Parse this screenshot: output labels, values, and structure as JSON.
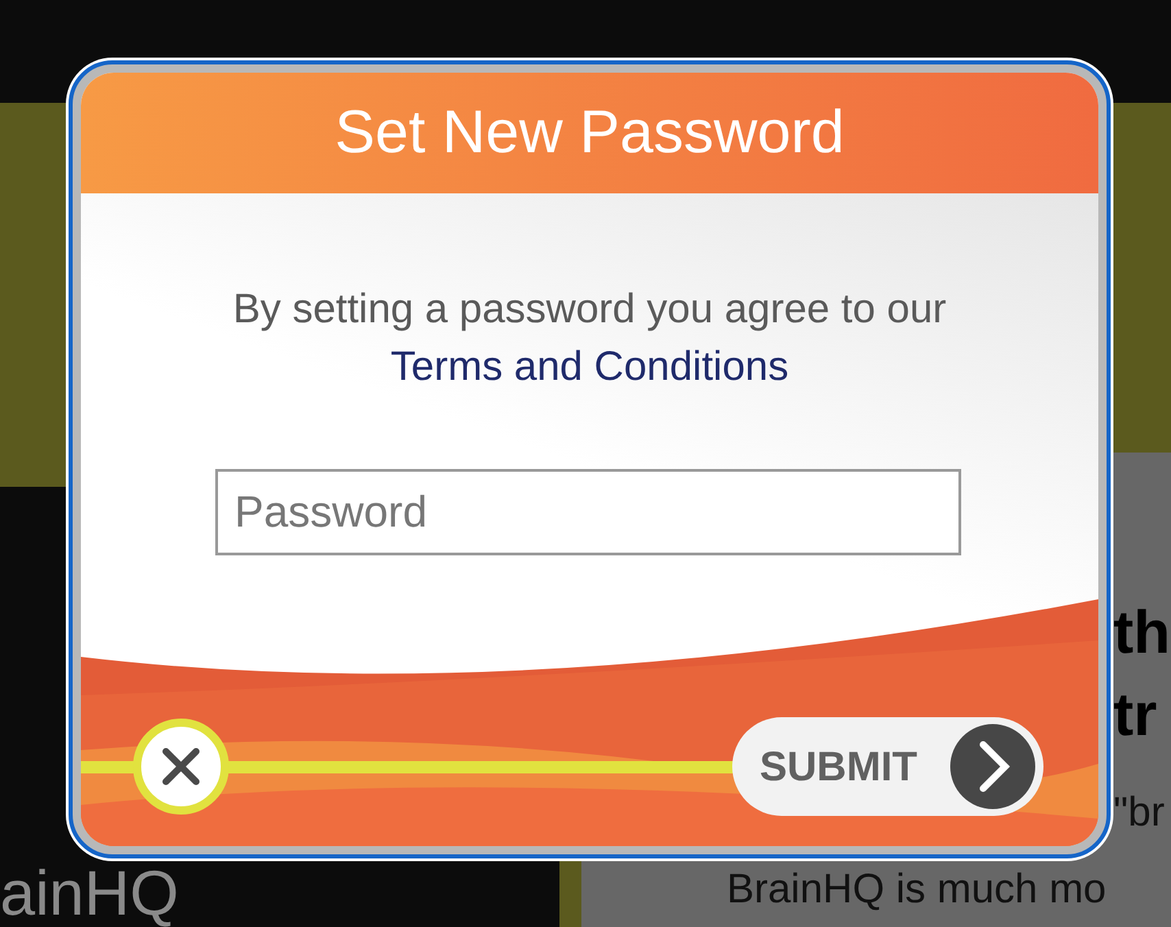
{
  "background": {
    "logo_text": "ainHQ",
    "heading_lines": [
      "th",
      "tr"
    ],
    "body_lines": [
      "\"br",
      "BrainHQ is much mo"
    ]
  },
  "dialog": {
    "title": "Set New Password",
    "message": "By setting a password you agree to our",
    "link": "Terms and Conditions",
    "password": {
      "placeholder": "Password"
    },
    "submit": "SUBMIT"
  }
}
